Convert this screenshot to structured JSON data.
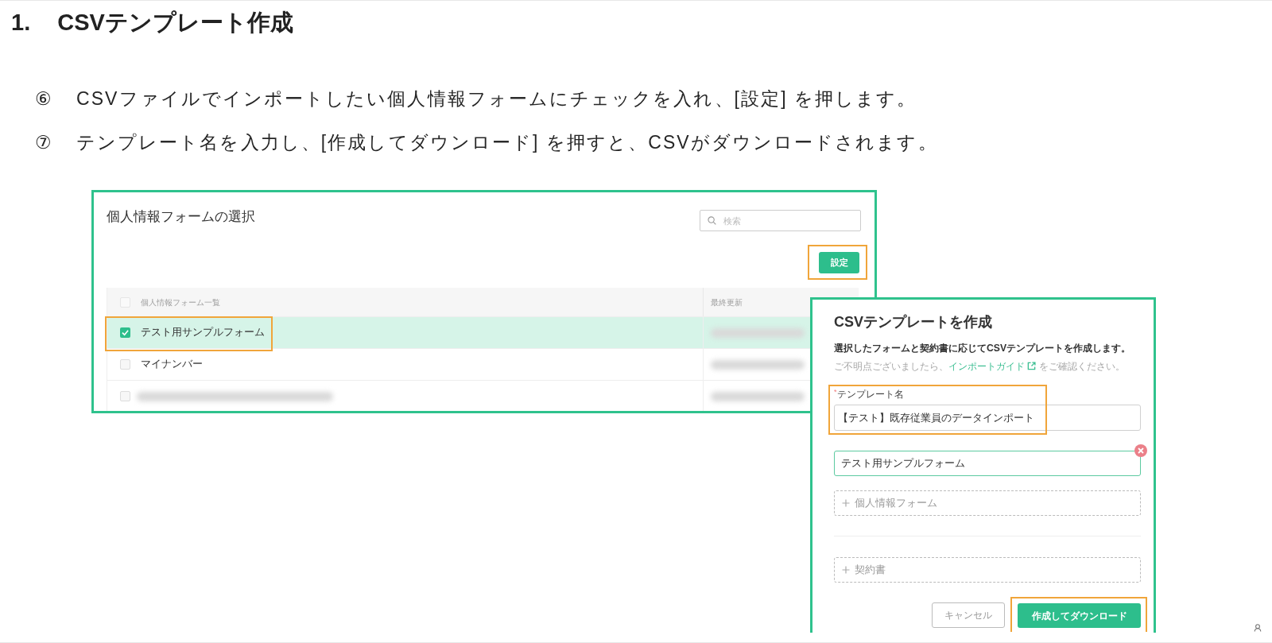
{
  "heading": {
    "number": "1.",
    "title": "CSVテンプレート作成"
  },
  "steps": [
    {
      "marker": "⑥",
      "text": "CSVファイルでインポートしたい個人情報フォームにチェックを入れ、[設定] を押します。"
    },
    {
      "marker": "⑦",
      "text": "テンプレート名を入力し、[作成してダウンロード] を押すと、CSVがダウンロードされます。"
    }
  ],
  "form_selection_panel": {
    "title": "個人情報フォームの選択",
    "search": {
      "placeholder": "検索"
    },
    "settings_button": {
      "label": "設定",
      "highlighted": true
    },
    "table": {
      "columns": [
        "個人情報フォーム一覧",
        "最終更新"
      ],
      "header_checked": false,
      "rows": [
        {
          "kind": "text",
          "name": "テスト用サンプルフォーム",
          "checked": true,
          "highlighted": true
        },
        {
          "kind": "text",
          "name": "マイナンバー",
          "checked": false,
          "highlighted": false
        },
        {
          "kind": "blurred",
          "checked": false,
          "highlighted": false
        }
      ]
    }
  },
  "csv_template_dialog": {
    "title": "CSVテンプレートを作成",
    "description": "選択したフォームと契約書に応じてCSVテンプレートを作成します。",
    "hint": {
      "before": "ご不明点ございましたら、",
      "link": "インポートガイド",
      "after": "をご確認ください。"
    },
    "template_name": {
      "required_mark": "*",
      "label": "テンプレート名",
      "value": "【テスト】既存従業員のデータインポート",
      "highlighted": true
    },
    "selected_forms": [
      "テスト用サンプルフォーム"
    ],
    "add_buttons": [
      "個人情報フォーム",
      "契約書"
    ],
    "buttons": [
      {
        "kind": "secondary",
        "label": "キャンセル",
        "highlighted": false
      },
      {
        "kind": "primary",
        "label": "作成してダウンロード",
        "highlighted": true
      }
    ]
  }
}
